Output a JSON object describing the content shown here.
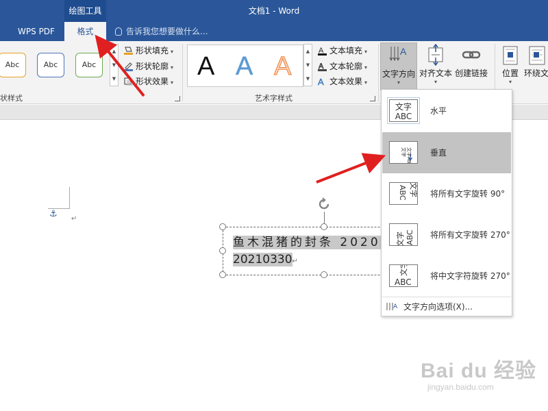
{
  "titlebar": {
    "context_tab": "绘图工具",
    "doc_title": "文档1 - Word",
    "tabs": [
      {
        "label": "WPS PDF"
      },
      {
        "label": "格式"
      }
    ],
    "tell_me": "告诉我您想要做什么..."
  },
  "ribbon": {
    "shape_styles": {
      "thumbs": [
        "Abc",
        "Abc",
        "Abc"
      ],
      "fill": "形状填充",
      "outline": "形状轮廓",
      "effects": "形状效果",
      "group_label": "状样式"
    },
    "wordart": {
      "letters": [
        "A",
        "A",
        "A"
      ],
      "text_fill": "文本填充",
      "text_outline": "文本轮廓",
      "text_effects": "文本效果",
      "group_label": "艺术字样式"
    },
    "text": {
      "direction": "文字方向",
      "align": "对齐文本",
      "link": "创建链接"
    },
    "arrange": {
      "position": "位置",
      "wrap": "环绕文"
    }
  },
  "document": {
    "textbox_line1": "鱼木混猪的封条  2020",
    "textbox_line2": "20210330"
  },
  "dropdown": {
    "items": [
      {
        "icon_text": "文字ABC",
        "label": "水平"
      },
      {
        "icon_text": "文字ABC",
        "label": "垂直"
      },
      {
        "icon_text": "文字ABC",
        "label": "将所有文字旋转 90°"
      },
      {
        "icon_text": "文字ABC",
        "label": "将所有文字旋转 270°"
      },
      {
        "icon_text": "文字ABC",
        "label": "将中文字符旋转 270°"
      }
    ],
    "options": "文字方向选项(X)..."
  },
  "watermark": {
    "brand": "Bai du 经验",
    "url": "jingyan.baidu.com"
  },
  "colors": {
    "accent": "#2b579a",
    "arrow": "#e02020"
  }
}
